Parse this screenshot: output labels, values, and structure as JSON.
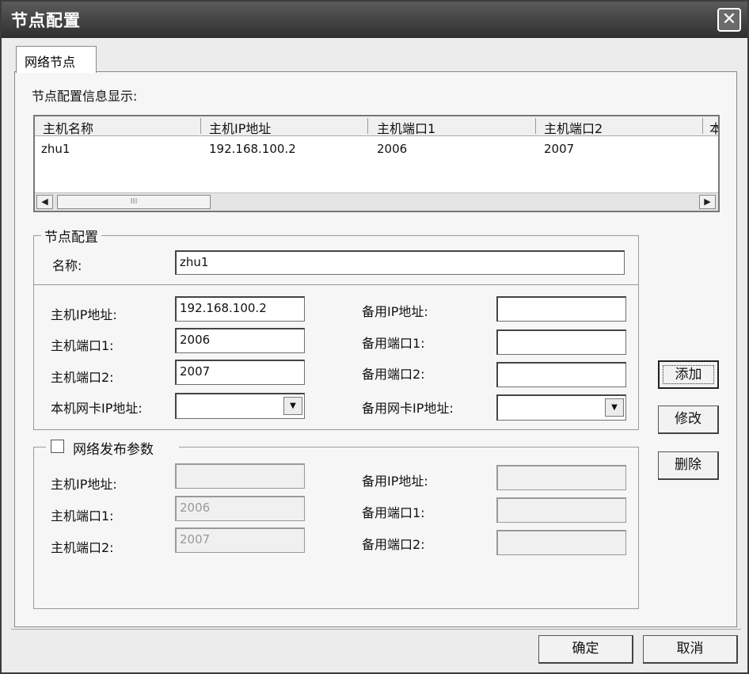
{
  "window": {
    "title": "节点配置",
    "close_glyph": "✕"
  },
  "tab": {
    "label": "网络节点"
  },
  "info_label": "节点配置信息显示:",
  "list": {
    "columns": [
      "主机名称",
      "主机IP地址",
      "主机端口1",
      "主机端口2",
      "本"
    ],
    "rows": [
      {
        "name": "zhu1",
        "ip": "192.168.100.2",
        "port1": "2006",
        "port2": "2007"
      }
    ],
    "scroll_left": "◀",
    "scroll_right": "▶",
    "thumb_grip": "III"
  },
  "node_config": {
    "legend": "节点配置",
    "name_label": "名称:",
    "name_value": "zhu1",
    "host_ip_label": "主机IP地址:",
    "host_ip_value": "192.168.100.2",
    "host_port1_label": "主机端口1:",
    "host_port1_value": "2006",
    "host_port2_label": "主机端口2:",
    "host_port2_value": "2007",
    "local_nic_label": "本机网卡IP地址:",
    "local_nic_value": "",
    "backup_ip_label": "备用IP地址:",
    "backup_ip_value": "",
    "backup_port1_label": "备用端口1:",
    "backup_port1_value": "",
    "backup_port2_label": "备用端口2:",
    "backup_port2_value": "",
    "backup_nic_label": "备用网卡IP地址:",
    "backup_nic_value": "",
    "dropdown_glyph": "▼"
  },
  "publish": {
    "checkbox_label": "网络发布参数",
    "checked": false,
    "host_ip_label": "主机IP地址:",
    "host_ip_value": "",
    "host_port1_label": "主机端口1:",
    "host_port1_value": "2006",
    "host_port2_label": "主机端口2:",
    "host_port2_value": "2007",
    "backup_ip_label": "备用IP地址:",
    "backup_ip_value": "",
    "backup_port1_label": "备用端口1:",
    "backup_port1_value": "",
    "backup_port2_label": "备用端口2:",
    "backup_port2_value": ""
  },
  "buttons": {
    "add": "添加",
    "modify": "修改",
    "delete": "删除",
    "ok": "确定",
    "cancel": "取消"
  }
}
